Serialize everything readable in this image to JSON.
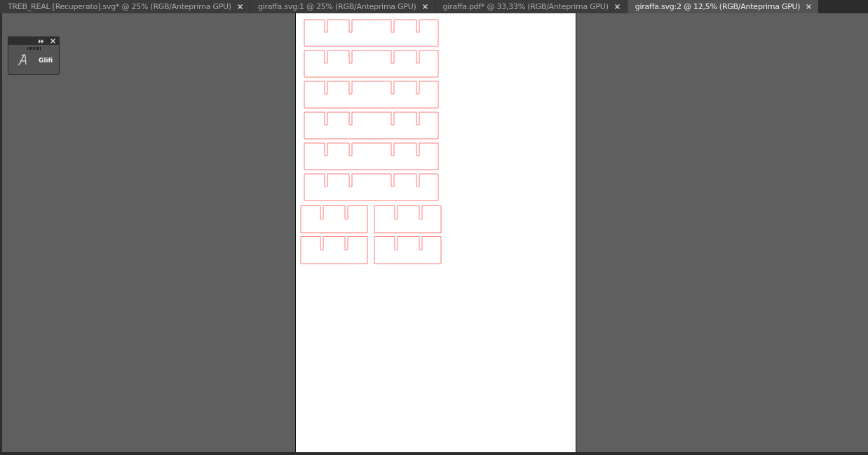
{
  "tabs": [
    {
      "label": "TREB_REAL [Recuperato].svg* @ 25% (RGB/Anteprima GPU)",
      "selected": false
    },
    {
      "label": "giraffa.svg:1 @ 25% (RGB/Anteprima GPU)",
      "selected": false
    },
    {
      "label": "giraffa.pdf* @ 33,33% (RGB/Anteprima GPU)",
      "selected": false
    },
    {
      "label": "giraffa.svg:2 @ 12,5% (RGB/Anteprima GPU)",
      "selected": true
    }
  ],
  "glyphs_panel": {
    "label": "Glifi"
  }
}
